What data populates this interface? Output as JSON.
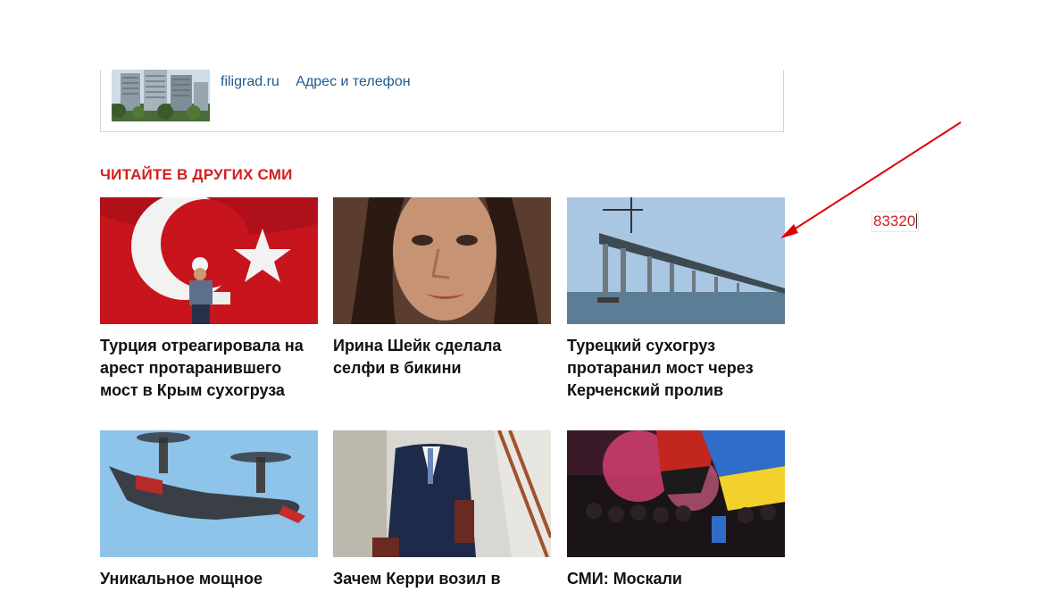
{
  "ad": {
    "site_link": "filigrad.ru",
    "contact_link": "Адрес и телефон"
  },
  "section_title": "ЧИТАЙТЕ В ДРУГИХ СМИ",
  "cards": [
    {
      "caption": "Турция отреагировала на арест протаранившего мост в Крым сухогруза"
    },
    {
      "caption": "Ирина Шейк сделала селфи в бикини"
    },
    {
      "caption": "Турецкий сухогруз протаранил мост через Керченский пролив"
    },
    {
      "caption": "Уникальное мощное"
    },
    {
      "caption": "Зачем Керри возил в"
    },
    {
      "caption": "СМИ: Москали"
    }
  ],
  "annotation": {
    "counter_value": "83320",
    "color": "#e00000"
  }
}
